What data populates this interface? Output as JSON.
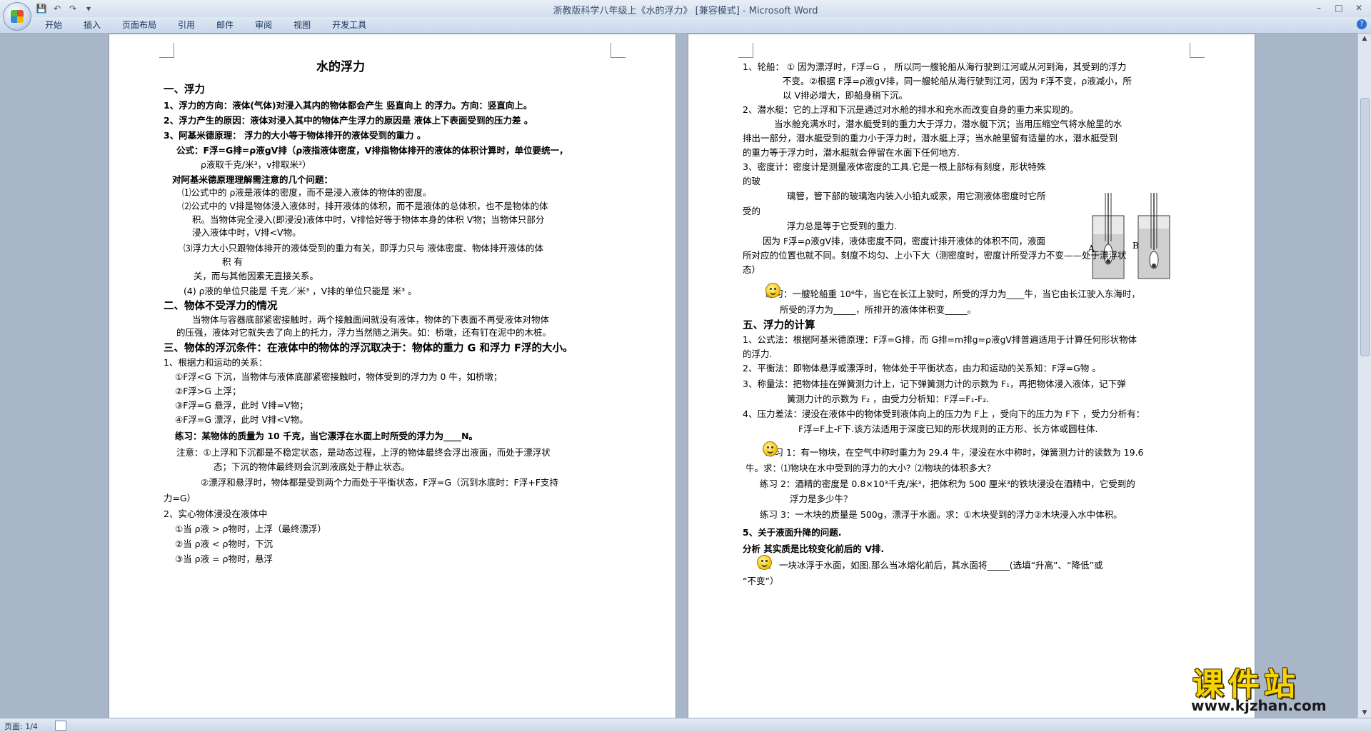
{
  "window": {
    "title": "浙教版科学八年级上《水的浮力》 [兼容模式] - ",
    "app_name": "Microsoft Word",
    "controls": {
      "minimize": "–",
      "maximize": "□",
      "close": "✕"
    }
  },
  "quick_access": {
    "save_icon": "💾",
    "undo_icon": "↶",
    "redo_icon": "↷",
    "more_icon": "▾"
  },
  "ribbon": {
    "tabs": [
      "开始",
      "插入",
      "页面布局",
      "引用",
      "邮件",
      "审阅",
      "视图",
      "开发工具"
    ],
    "help_icon": "?"
  },
  "status": {
    "page": "页面: 1/4"
  },
  "watermark": {
    "text": "课件站",
    "url": "www.kjzhan.com"
  },
  "left_page": {
    "lines": [
      "水的浮力",
      "一、浮力",
      "1、浮力的方向：液体(气体)对浸入其内的物体都会产生 竖直向上 的浮力。方向：竖直向上。",
      "2、浮力产生的原因：液体对浸入其中的物体产生浮力的原因是 液体上下表面受到的压力差 。",
      "3、阿基米德原理： 浮力的大小等于物体排开的液体受到的重力 。",
      "公式：F浮=G排=ρ液gV排（ρ液指液体密度，V排指物体排开的液体的体积计算时，单位要统一，",
      "ρ液取千克/米³，v排取米³）",
      "对阿基米德原理理解需注意的几个问题：",
      "⑴公式中的 ρ液是液体的密度，而不是浸入液体的物体的密度。",
      "⑵公式中的 V排是物体浸入液体时，排开液体的体积，而不是液体的总体积，也不是物体的体",
      "积。当物体完全浸入(即浸没)液体中时，V排恰好等于物体本身的体积 V物；当物体只部分",
      "浸入液体中时，V排<V物。",
      "⑶浮力大小只跟物体排开的液体受到的重力有关，即浮力只与 液体密度、物体排开液体的体",
      "积 有",
      "关，而与其他因素无直接关系。",
      "(4) ρ液的单位只能是 千克／米³ ，V排的单位只能是 米³ 。",
      "二、物体不受浮力的情况",
      "当物体与容器底部紧密接触时，两个接触面间就没有液体，物体的下表面不再受液体对物体",
      "的压强，液体对它就失去了向上的托力，浮力当然随之消失。如：桥墩，还有钉在泥中的木桩。",
      "三、物体的浮沉条件：在液体中的物体的浮沉取决于：物体的重力 G 和浮力 F浮的大小。",
      "1、根据力和运动的关系：",
      "①F浮<G 下沉，当物体与液体底部紧密接触时，物体受到的浮力为 0 牛，如桥墩；",
      "②F浮>G 上浮；",
      "③F浮=G 悬浮，此时 V排=V物；",
      "④F浮=G 漂浮，此时 V排<V物。",
      "练习：某物体的质量为 10 千克，当它漂浮在水面上时所受的浮力为____N。",
      "注意：①上浮和下沉都是不稳定状态，是动态过程，上浮的物体最终会浮出液面，而处于漂浮状",
      "态；下沉的物体最终则会沉到液底处于静止状态。",
      "②漂浮和悬浮时，物体都是受到两个力而处于平衡状态，F浮=G（沉到水底时：F浮+F支持",
      "力=G）",
      "2、实心物体浸没在液体中",
      "①当 ρ液 > ρ物时，上浮（最终漂浮）",
      "②当 ρ液 < ρ物时，下沉",
      "③当 ρ液 = ρ物时，悬浮"
    ]
  },
  "right_page": {
    "lines": [
      "1、轮船： ① 因为漂浮时，F浮=G ， 所以同一艘轮船从海行驶到江河或从河到海，其受到的浮力",
      "不变。②根据 F浮=ρ液gV排，同一艘轮船从海行驶到江河，因为 F浮不变，ρ液减小，所",
      "以 V排必增大，即船身稍下沉。",
      "2、潜水艇：它的上浮和下沉是通过对水舱的排水和充水而改变自身的重力来实现的。",
      "当水舱充满水时，潜水艇受到的重力大于浮力，潜水艇下沉；当用压缩空气将水舱里的水",
      "排出一部分，潜水艇受到的重力小于浮力时，潜水艇上浮；当水舱里留有适量的水，潜水艇受到",
      "的重力等于浮力时，潜水艇就会停留在水面下任何地方.",
      "3、密度计：密度计是测量液体密度的工具.它是一根上部标有刻度，形状特殊",
      "的玻",
      "璃管，管下部的玻璃泡内装入小铅丸或汞，用它测液体密度时它所",
      "受的",
      "浮力总是等于它受到的重力.",
      "因为 F浮=ρ液gV排，液体密度不同，密度计排开液体的体积不同，液面",
      "所对应的位置也就不同。刻度不均匀、上小下大（测密度时，密度计所受浮力不变——处于漂浮状",
      "态）",
      "练习：一艘轮船重 10⁶牛，当它在长江上驶时，所受的浮力为____牛，当它由长江驶入东海时，",
      "所受的浮力为_____，所排开的液体体积变_____。",
      "五、浮力的计算",
      "1、公式法：根据阿基米德原理：F浮=G排，而 G排=m排g=ρ液gV排普遍适用于计算任何形状物体",
      "的浮力.",
      "2、平衡法：即物体悬浮或漂浮时，物体处于平衡状态，由力和运动的关系知：F浮=G物 。",
      "3、称量法：把物体挂在弹簧测力计上，记下弹簧测力计的示数为 F₁，再把物体浸入液体，记下弹",
      "簧测力计的示数为 F₂ ，由受力分析知：F浮=F₁-F₂.",
      "4、压力差法：浸没在液体中的物体受到液体向上的压力为 F上 ，受向下的压力为 F下 ，受力分析有：",
      "F浮=F上-F下.该方法适用于深度已知的形状规则的正方形、长方体或圆柱体.",
      "练习 1：有一物块，在空气中称时重力为 29.4 牛，浸没在水中称时，弹簧测力计的读数为 19.6",
      "牛。求：⑴物块在水中受到的浮力的大小？⑵物块的体积多大？",
      "练习 2：酒精的密度是 0.8×10³千克/米³，把体积为 500 厘米³的铁块浸没在酒精中，它受到的",
      "浮力是多少牛？",
      "练习 3：一木块的质量是 500g，漂浮于水面。求：①木块受到的浮力②木块浸入水中体积。",
      "5、关于液面升降的问题.",
      "分析 其实质是比较变化前后的 V排.",
      "例： 一块冰浮于水面，如图.那么当冰熔化前后，其水面将_____(选填“升高”、“降低”或",
      "“不变”）"
    ],
    "hydrometer_labels": [
      "A",
      "B"
    ]
  }
}
